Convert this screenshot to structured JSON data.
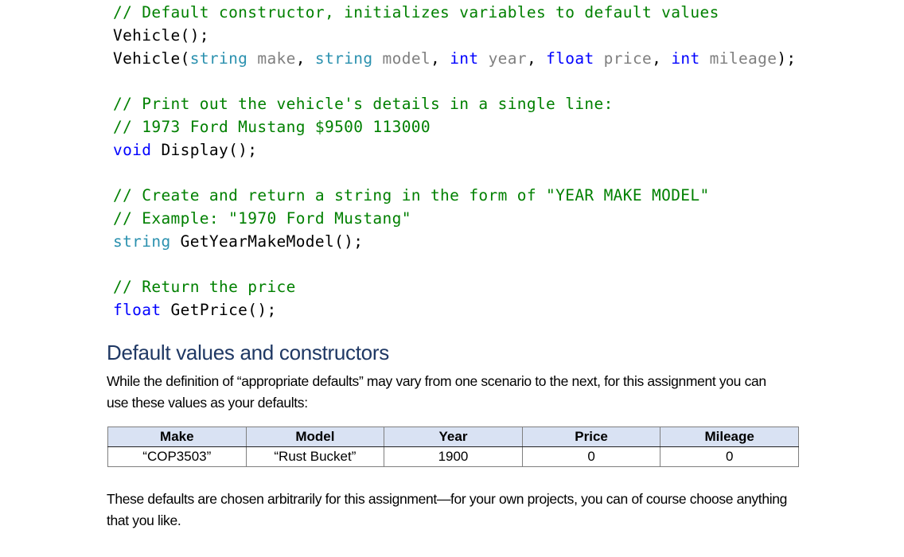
{
  "code_blocks": [
    {
      "lines": [
        [
          {
            "t": "// Default constructor, initializes variables to default values",
            "k": "comment"
          }
        ],
        [
          {
            "t": "Vehicle();",
            "k": "plain"
          }
        ],
        [
          {
            "t": "Vehicle(",
            "k": "plain"
          },
          {
            "t": "string",
            "k": "class"
          },
          {
            "t": " make",
            "k": "param"
          },
          {
            "t": ", ",
            "k": "plain"
          },
          {
            "t": "string",
            "k": "class"
          },
          {
            "t": " model",
            "k": "param"
          },
          {
            "t": ", ",
            "k": "plain"
          },
          {
            "t": "int",
            "k": "type"
          },
          {
            "t": " year",
            "k": "param"
          },
          {
            "t": ", ",
            "k": "plain"
          },
          {
            "t": "float",
            "k": "type"
          },
          {
            "t": " price",
            "k": "param"
          },
          {
            "t": ", ",
            "k": "plain"
          },
          {
            "t": "int",
            "k": "type"
          },
          {
            "t": " mileage",
            "k": "param"
          },
          {
            "t": ");",
            "k": "plain"
          }
        ]
      ]
    },
    {
      "lines": [
        [
          {
            "t": "// Print out the vehicle's details in a single line:",
            "k": "comment"
          }
        ],
        [
          {
            "t": "// 1973 Ford Mustang $9500 113000",
            "k": "comment"
          }
        ],
        [
          {
            "t": "void",
            "k": "type"
          },
          {
            "t": " Display();",
            "k": "plain"
          }
        ]
      ]
    },
    {
      "lines": [
        [
          {
            "t": "// Create and return a string in the form of \"YEAR MAKE MODEL\"",
            "k": "comment"
          }
        ],
        [
          {
            "t": "// Example: \"1970 Ford Mustang\"",
            "k": "comment"
          }
        ],
        [
          {
            "t": "string",
            "k": "class"
          },
          {
            "t": " GetYearMakeModel();",
            "k": "plain"
          }
        ]
      ]
    },
    {
      "lines": [
        [
          {
            "t": "// Return the price",
            "k": "comment"
          }
        ],
        [
          {
            "t": "float",
            "k": "type"
          },
          {
            "t": " GetPrice();",
            "k": "plain"
          }
        ]
      ]
    }
  ],
  "section": {
    "heading": "Default values and constructors",
    "intro": "While the definition of “appropriate defaults” may vary from one scenario to the next, for this assignment you can use these values as your defaults:",
    "table": {
      "headers": [
        "Make",
        "Model",
        "Year",
        "Price",
        "Mileage"
      ],
      "rows": [
        [
          "“COP3503”",
          "“Rust Bucket”",
          "1900",
          "0",
          "0"
        ]
      ]
    },
    "outro": "These defaults are chosen arbitrarily for this assignment—for your own projects, you can of course choose anything that you like."
  },
  "colors": {
    "comment": "#008000",
    "keyword_type": "#0000ff",
    "class_type": "#2b91af",
    "parameter": "#808080",
    "heading": "#1f3864",
    "table_header_bg": "#d9e2f3"
  }
}
